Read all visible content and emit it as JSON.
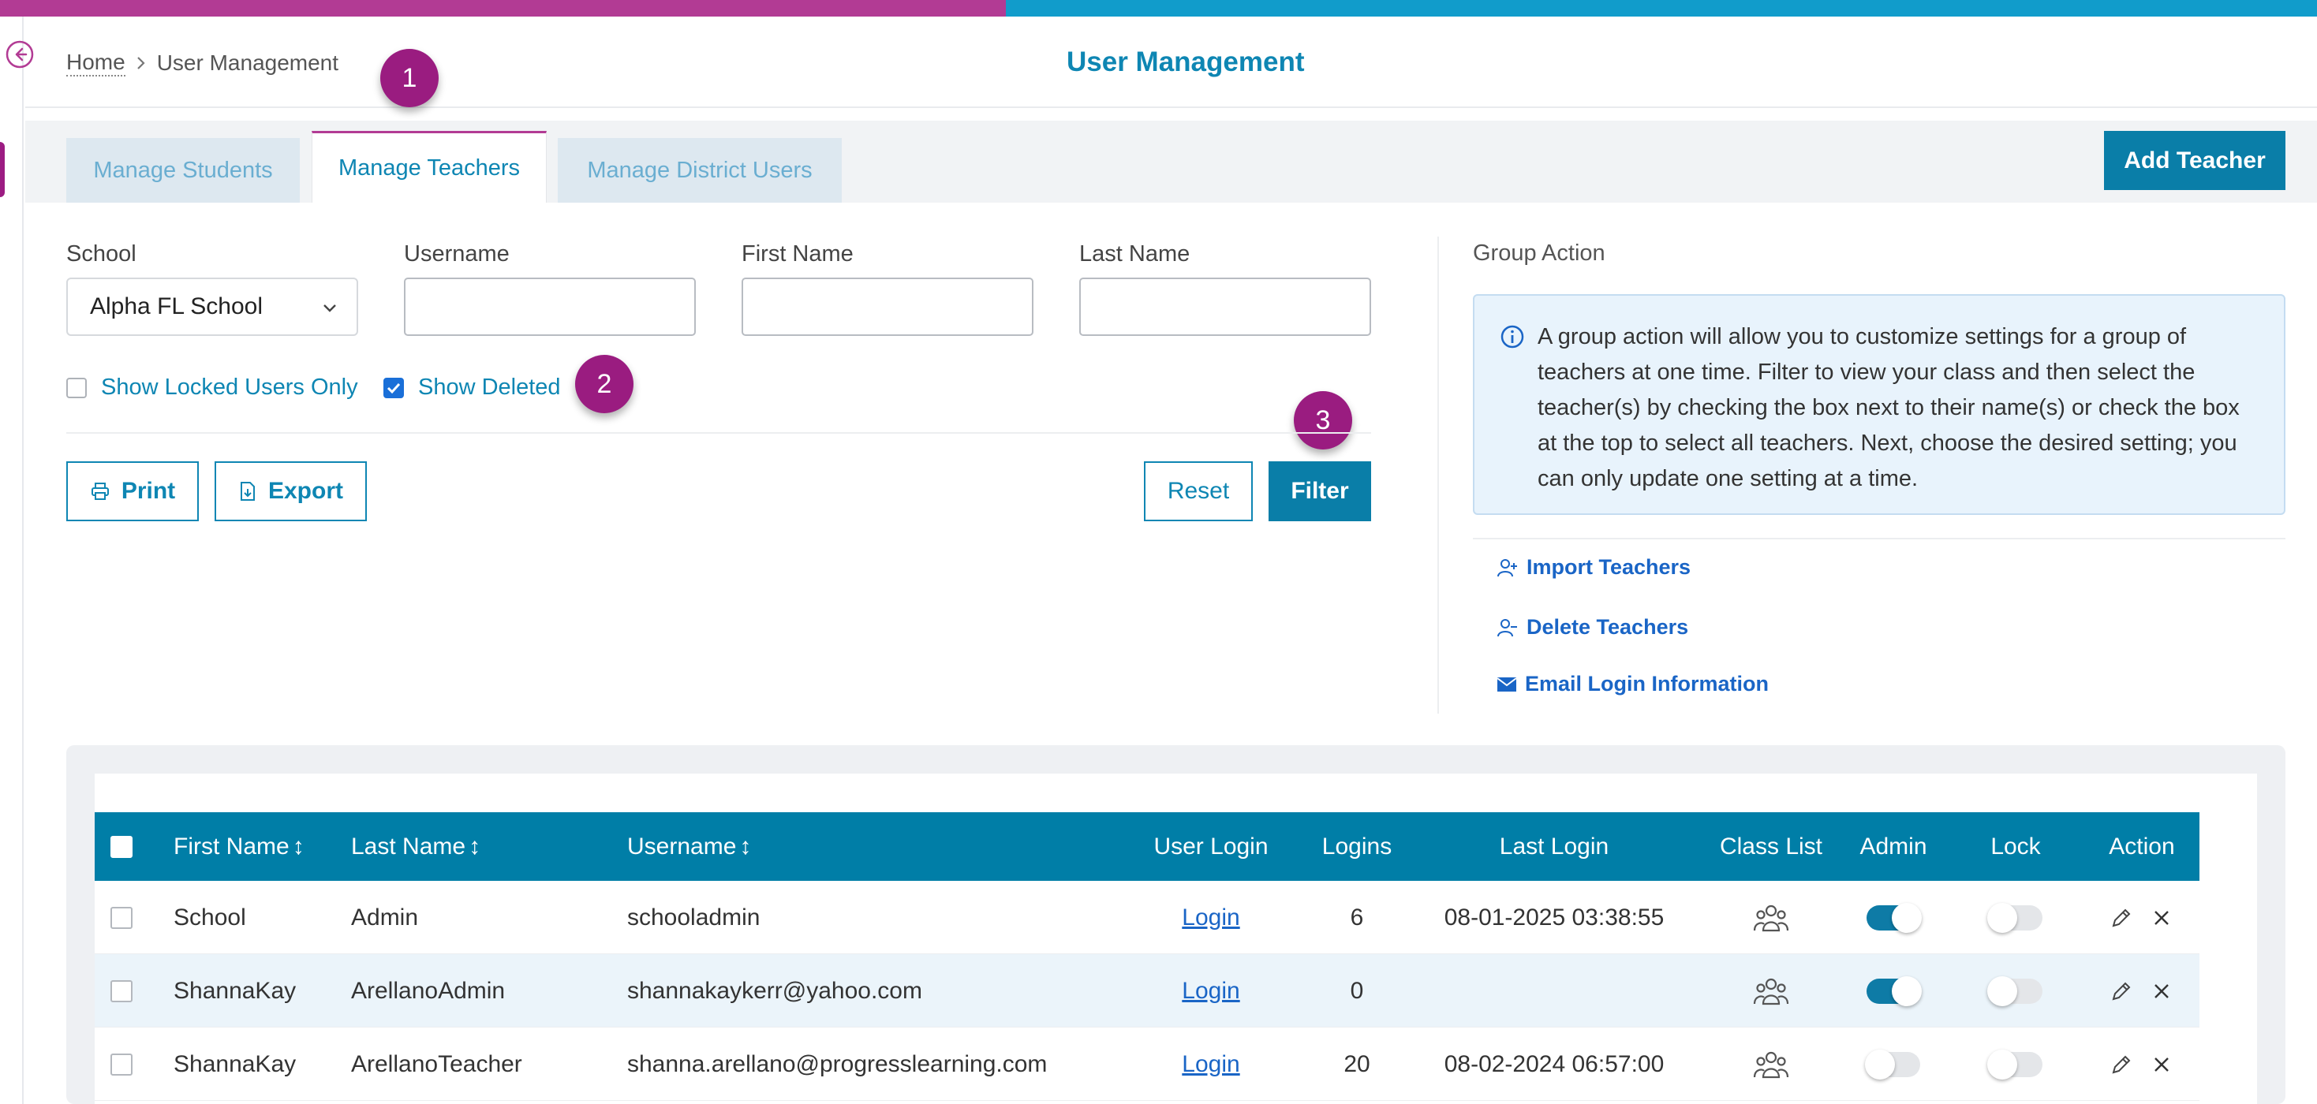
{
  "colors": {
    "accent": "#0e86b3",
    "brand_magenta": "#b23b94",
    "primary_button": "#0a7ea8",
    "table_header": "#007ea7",
    "step_badge": "#9a1c80"
  },
  "breadcrumb": {
    "home": "Home",
    "current": "User Management"
  },
  "page_title": "User Management",
  "steps": [
    "1",
    "2",
    "3"
  ],
  "tabs": [
    {
      "label": "Manage Students",
      "active": false
    },
    {
      "label": "Manage Teachers",
      "active": true
    },
    {
      "label": "Manage District Users",
      "active": false
    }
  ],
  "add_teacher_label": "Add Teacher",
  "filters": {
    "school_label": "School",
    "school_value": "Alpha FL School",
    "username_label": "Username",
    "username_value": "",
    "first_name_label": "First Name",
    "first_name_value": "",
    "last_name_label": "Last Name",
    "last_name_value": "",
    "show_locked_label": "Show Locked Users Only",
    "show_locked_checked": false,
    "show_deleted_label": "Show Deleted",
    "show_deleted_checked": true
  },
  "actions": {
    "print": "Print",
    "export": "Export",
    "reset": "Reset",
    "filter": "Filter"
  },
  "group_action": {
    "title": "Group Action",
    "info": "A group action will allow you to customize settings for a group of teachers at one time. Filter to view your class and then select the teacher(s) by checking the box next to their name(s) or check the box at the top to select all teachers. Next, choose the desired setting; you can only update one setting at a time.",
    "links": [
      {
        "label": "Import Teachers",
        "icon": "add-user-icon"
      },
      {
        "label": "Delete Teachers",
        "icon": "remove-user-icon"
      },
      {
        "label": "Email Login Information",
        "icon": "envelope-icon"
      }
    ]
  },
  "table": {
    "columns": {
      "first_name": "First Name",
      "last_name": "Last Name",
      "username": "Username",
      "user_login": "User Login",
      "logins": "Logins",
      "last_login": "Last Login",
      "class_list": "Class List",
      "admin": "Admin",
      "lock": "Lock",
      "action": "Action"
    },
    "sort_glyph": "↕",
    "rows": [
      {
        "first": "School",
        "last": "Admin",
        "username": "schooladmin",
        "login": "Login",
        "logins": "6",
        "last_login": "08-01-2025 03:38:55",
        "admin": true,
        "lock": false
      },
      {
        "first": "ShannaKay",
        "last": "ArellanoAdmin",
        "username": "shannakaykerr@yahoo.com",
        "login": "Login",
        "logins": "0",
        "last_login": "",
        "admin": true,
        "lock": false
      },
      {
        "first": "ShannaKay",
        "last": "ArellanoTeacher",
        "username": "shanna.arellano@progresslearning.com",
        "login": "Login",
        "logins": "20",
        "last_login": "08-02-2024 06:57:00",
        "admin": false,
        "lock": false
      }
    ]
  }
}
